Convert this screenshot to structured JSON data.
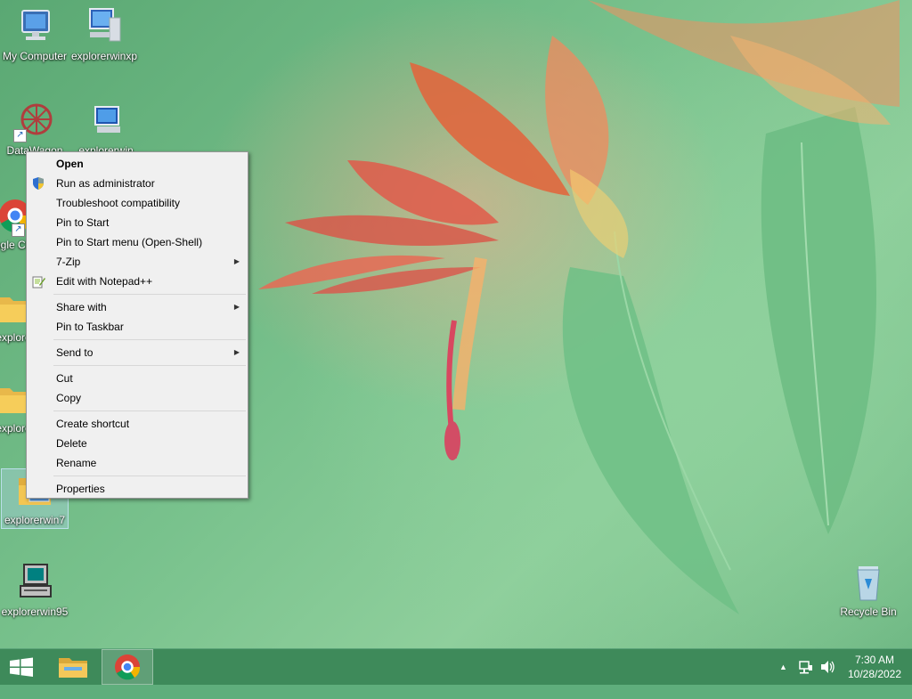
{
  "desktop": {
    "icons": [
      {
        "label": "My Computer"
      },
      {
        "label": "explorerwinxp"
      },
      {
        "label": "DataWagon"
      },
      {
        "label": "explorerwin"
      },
      {
        "label": "Google Chrome"
      },
      {
        "label": "explorer"
      },
      {
        "label": "explorer"
      },
      {
        "label": "explorerwin7"
      },
      {
        "label": "explorerwin95"
      },
      {
        "label": "Recycle Bin"
      }
    ]
  },
  "context_menu": {
    "items": [
      {
        "label": "Open"
      },
      {
        "label": "Run as administrator"
      },
      {
        "label": "Troubleshoot compatibility"
      },
      {
        "label": "Pin to Start"
      },
      {
        "label": "Pin to Start menu (Open-Shell)"
      },
      {
        "label": "7-Zip"
      },
      {
        "label": "Edit with Notepad++"
      },
      {
        "label": "Share with"
      },
      {
        "label": "Pin to Taskbar"
      },
      {
        "label": "Send to"
      },
      {
        "label": "Cut"
      },
      {
        "label": "Copy"
      },
      {
        "label": "Create shortcut"
      },
      {
        "label": "Delete"
      },
      {
        "label": "Rename"
      },
      {
        "label": "Properties"
      }
    ]
  },
  "taskbar": {
    "time": "7:30 AM",
    "date": "10/28/2022",
    "tray_chevron": "▲",
    "accent": "#3e8a5a"
  }
}
